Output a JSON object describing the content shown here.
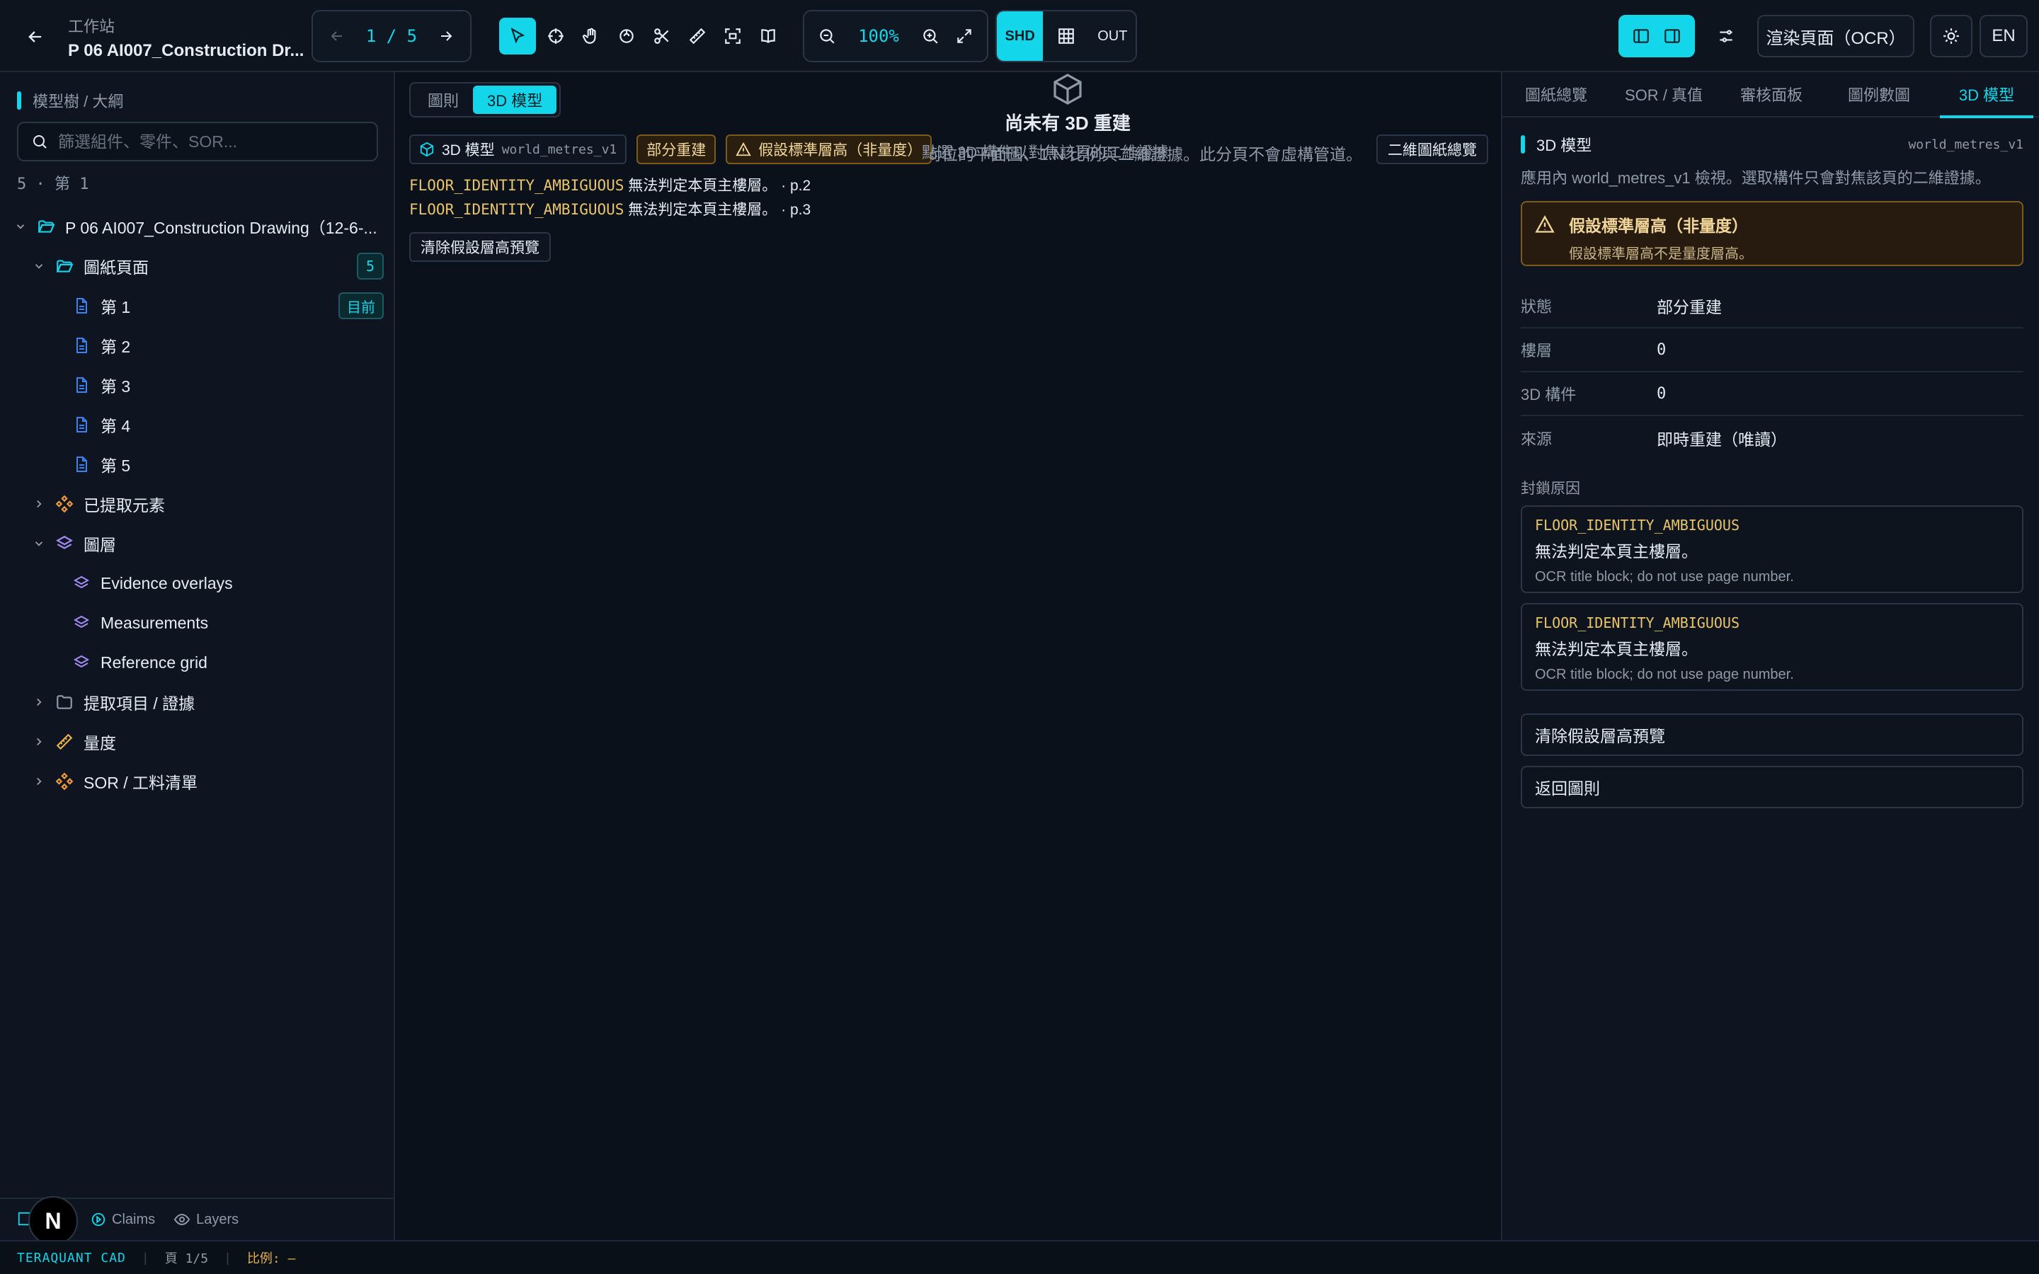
{
  "header": {
    "workspace_label": "工作站",
    "doc_title": "P 06 AI007_Construction Dr...",
    "page_indicator": "1 / 5",
    "zoom": "100%",
    "mode_shd": "SHD",
    "mode_out": "OUT",
    "render_button": "渲染頁面（OCR）",
    "lang_button": "EN"
  },
  "left": {
    "header": "模型樹 / 大綱",
    "search_placeholder": "篩選組件、零件、SOR...",
    "count": "5 · 第 1",
    "tree": {
      "root": "P 06 AI007_Construction Drawing（12-6-...",
      "pages_group": "圖紙頁面",
      "pages_count": "5",
      "pages": [
        "第 1",
        "第 2",
        "第 3",
        "第 4",
        "第 5"
      ],
      "current_badge": "目前",
      "extracted": "已提取元素",
      "layers": "圖層",
      "layer_items": [
        "Evidence overlays",
        "Measurements",
        "Reference grid"
      ],
      "claims": "提取項目 / 證據",
      "measure": "量度",
      "sor": "SOR / 工料清單"
    },
    "footer": {
      "claims": "Claims",
      "layers": "Layers"
    },
    "avatar": "N"
  },
  "center": {
    "tabs": [
      "圖則",
      "3D 模型"
    ],
    "model_chip": "3D 模型",
    "model_chip_mono": "world_metres_v1",
    "partial_chip": "部分重建",
    "warn_chip": "假設標準層高（非量度）",
    "hint": "點選 3D 構件以對焦該頁的二維證據",
    "overview_button": "二維圖紙總覽",
    "issues": [
      {
        "code": "FLOOR_IDENTITY_AMBIGUOUS",
        "msg": "無法判定本頁主樓層。 · p.2"
      },
      {
        "code": "FLOOR_IDENTITY_AMBIGUOUS",
        "msg": "無法判定本頁主樓層。 · p.3"
      }
    ],
    "clear_button": "清除假設層高預覽",
    "empty_title": "尚未有 3D 重建",
    "empty_sub": "需要已對位的平面圖、1:N 比例與二維證據。此分頁不會虛構管道。"
  },
  "right": {
    "tabs": [
      "圖紙總覽",
      "SOR / 真值",
      "審核面板",
      "圖例數圖",
      "3D 模型"
    ],
    "section_title": "3D 模型",
    "section_mono": "world_metres_v1",
    "desc": "應用內 world_metres_v1 檢視。選取構件只會對焦該頁的二維證據。",
    "warn_title": "假設標準層高（非量度）",
    "warn_body": "假設標準層高不是量度層高。",
    "kv": [
      {
        "k": "狀態",
        "v": "部分重建"
      },
      {
        "k": "樓層",
        "v": "0"
      },
      {
        "k": "3D 構件",
        "v": "0"
      },
      {
        "k": "來源",
        "v": "即時重建（唯讀）"
      }
    ],
    "blocked_label": "封鎖原因",
    "reasons": [
      {
        "code": "FLOOR_IDENTITY_AMBIGUOUS",
        "msg": "無法判定本頁主樓層。",
        "note": "OCR title block; do not use page number."
      },
      {
        "code": "FLOOR_IDENTITY_AMBIGUOUS",
        "msg": "無法判定本頁主樓層。",
        "note": "OCR title block; do not use page number."
      }
    ],
    "btn_clear": "清除假設層高預覽",
    "btn_back": "返回圖則"
  },
  "status": {
    "brand": "TERAQUANT CAD",
    "page": "頁 1/5",
    "scale": "比例: —"
  },
  "colors": {
    "accent": "#14d6ea",
    "warn": "#e7b04a",
    "code": "#e9c46a"
  }
}
